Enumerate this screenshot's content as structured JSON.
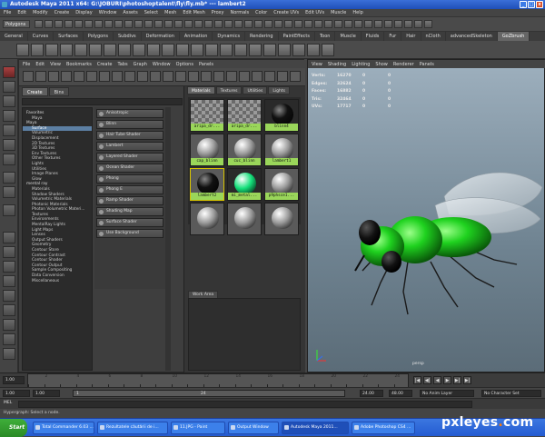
{
  "window": {
    "title": "Autodesk Maya 2011 x64: G:\\JOBURI\\photoshoptalent\\fly\\fly.mb* --- lambert2",
    "min_glyph": "_",
    "max_glyph": "□",
    "close_glyph": "x"
  },
  "main_menu": [
    "File",
    "Edit",
    "Modify",
    "Create",
    "Display",
    "Window",
    "Assets",
    "Select",
    "Mesh",
    "Edit Mesh",
    "Proxy",
    "Normals",
    "Color",
    "Create UVs",
    "Edit UVs",
    "Muscle",
    "Help"
  ],
  "status_line": {
    "mode": "Polygons"
  },
  "shelf_tabs": [
    {
      "label": "General",
      "active": false
    },
    {
      "label": "Curves",
      "active": false
    },
    {
      "label": "Surfaces",
      "active": false
    },
    {
      "label": "Polygons",
      "active": false
    },
    {
      "label": "Subdivs",
      "active": false
    },
    {
      "label": "Deformation",
      "active": false
    },
    {
      "label": "Animation",
      "active": false
    },
    {
      "label": "Dynamics",
      "active": false
    },
    {
      "label": "Rendering",
      "active": false
    },
    {
      "label": "PaintEffects",
      "active": false
    },
    {
      "label": "Toon",
      "active": false
    },
    {
      "label": "Muscle",
      "active": false
    },
    {
      "label": "Fluids",
      "active": false
    },
    {
      "label": "Fur",
      "active": false
    },
    {
      "label": "Hair",
      "active": false
    },
    {
      "label": "nCloth",
      "active": false
    },
    {
      "label": "advancedSkeleton",
      "active": false
    },
    {
      "label": "GoZbrush",
      "active": true
    }
  ],
  "hypershade": {
    "menu": [
      "File",
      "Edit",
      "View",
      "Bookmarks",
      "Create",
      "Tabs",
      "Graph",
      "Window",
      "Options",
      "Panels"
    ],
    "create_tabs": [
      {
        "label": "Create",
        "active": true
      },
      {
        "label": "Bins",
        "active": false
      }
    ],
    "tree": [
      {
        "label": "Favorites",
        "kind": "sec",
        "selected": false
      },
      {
        "label": "Maya",
        "kind": "c1",
        "selected": false
      },
      {
        "label": "Maya",
        "kind": "sec",
        "selected": false
      },
      {
        "label": "Surface",
        "kind": "c1",
        "selected": true
      },
      {
        "label": "Volumetric",
        "kind": "c1",
        "selected": false
      },
      {
        "label": "Displacement",
        "kind": "c1",
        "selected": false
      },
      {
        "label": "2D Textures",
        "kind": "c1",
        "selected": false
      },
      {
        "label": "3D Textures",
        "kind": "c1",
        "selected": false
      },
      {
        "label": "Env Textures",
        "kind": "c1",
        "selected": false
      },
      {
        "label": "Other Textures",
        "kind": "c1",
        "selected": false
      },
      {
        "label": "Lights",
        "kind": "c1",
        "selected": false
      },
      {
        "label": "Utilities",
        "kind": "c1",
        "selected": false
      },
      {
        "label": "Image Planes",
        "kind": "c1",
        "selected": false
      },
      {
        "label": "Glow",
        "kind": "c1",
        "selected": false
      },
      {
        "label": "mental ray",
        "kind": "sec",
        "selected": false
      },
      {
        "label": "Materials",
        "kind": "c1",
        "selected": false
      },
      {
        "label": "Shadow Shaders",
        "kind": "c1",
        "selected": false
      },
      {
        "label": "Volumetric Materials",
        "kind": "c1",
        "selected": false
      },
      {
        "label": "Photonic Materials",
        "kind": "c1",
        "selected": false
      },
      {
        "label": "Photon Volumetric Materi...",
        "kind": "c1",
        "selected": false
      },
      {
        "label": "Textures",
        "kind": "c1",
        "selected": false
      },
      {
        "label": "Environments",
        "kind": "c1",
        "selected": false
      },
      {
        "label": "MentalRay Lights",
        "kind": "c1",
        "selected": false
      },
      {
        "label": "Light Maps",
        "kind": "c1",
        "selected": false
      },
      {
        "label": "Lenses",
        "kind": "c1",
        "selected": false
      },
      {
        "label": "Output Shaders",
        "kind": "c1",
        "selected": false
      },
      {
        "label": "Geometry",
        "kind": "c1",
        "selected": false
      },
      {
        "label": "Contour Store",
        "kind": "c1",
        "selected": false
      },
      {
        "label": "Contour Contrast",
        "kind": "c1",
        "selected": false
      },
      {
        "label": "Contour Shader",
        "kind": "c1",
        "selected": false
      },
      {
        "label": "Contour Output",
        "kind": "c1",
        "selected": false
      },
      {
        "label": "Sample Compositing",
        "kind": "c1",
        "selected": false
      },
      {
        "label": "Data Conversion",
        "kind": "c1",
        "selected": false
      },
      {
        "label": "Miscellaneous",
        "kind": "c1",
        "selected": false
      }
    ],
    "nodes": [
      "Anisotropic",
      "Blinn",
      "Hair Tube Shader",
      "Lambert",
      "Layered Shader",
      "Ocean Shader",
      "Phong",
      "Phong E",
      "Ramp Shader",
      "Shading Map",
      "Surface Shader",
      "Use Background"
    ],
    "material_tabs": [
      {
        "label": "Materials",
        "active": true
      },
      {
        "label": "Textures",
        "active": false
      },
      {
        "label": "Utilities",
        "active": false
      },
      {
        "label": "Lights",
        "active": false
      }
    ],
    "swatches": [
      {
        "label": "aripa_dr...",
        "style": "checker",
        "ball": "none"
      },
      {
        "label": "aripa_dr...",
        "style": "checker",
        "ball": "none"
      },
      {
        "label": "blinn4",
        "style": "dark",
        "ball": "#111111"
      },
      {
        "label": "cap_blinn",
        "style": "plain",
        "ball": "#9a9a9a"
      },
      {
        "label": "cuc_blinn",
        "style": "plain",
        "ball": "#9a9a9a"
      },
      {
        "label": "lambert1",
        "style": "plain",
        "ball": "#9a9a9a"
      },
      {
        "label": "lambert2",
        "style": "yel",
        "ball": "#0d0d0d"
      },
      {
        "label": "mi_metal...",
        "style": "dark",
        "ball": "#14e07a"
      },
      {
        "label": "p9phsce1...",
        "style": "plain",
        "ball": "#9a9a9a"
      },
      {
        "label": "",
        "style": "plain",
        "ball": "#9a9a9a"
      },
      {
        "label": "",
        "style": "plain",
        "ball": "#9a9a9a"
      },
      {
        "label": "",
        "style": "plain",
        "ball": "#9a9a9a"
      }
    ],
    "work_area_tab": "Work Area"
  },
  "viewport": {
    "menu": [
      "View",
      "Shading",
      "Lighting",
      "Show",
      "Renderer",
      "Panels"
    ],
    "hud": [
      {
        "label": "Verts:",
        "v1": "16270",
        "v2": "0",
        "v3": "0"
      },
      {
        "label": "Edges:",
        "v1": "32624",
        "v2": "0",
        "v3": "0"
      },
      {
        "label": "Faces:",
        "v1": "16882",
        "v2": "0",
        "v3": "0"
      },
      {
        "label": "Tris:",
        "v1": "32464",
        "v2": "0",
        "v3": "0"
      },
      {
        "label": "UVs:",
        "v1": "17717",
        "v2": "0",
        "v3": "0"
      }
    ],
    "camera_label": "persp"
  },
  "timeline": {
    "ticks": [
      "2",
      "4",
      "6",
      "8",
      "10",
      "12",
      "14",
      "16",
      "18",
      "20",
      "22",
      "24"
    ],
    "current_frame": "1.00",
    "buttons": [
      "|◀",
      "◀|",
      "◀",
      "▶",
      "▶|",
      "▶|"
    ]
  },
  "range": {
    "start": "1.00",
    "start2": "1.00",
    "slider_lo": "1",
    "slider_hi": "24",
    "end": "24.00",
    "end2": "48.00",
    "anim_layer": "No Anim Layer",
    "char_set": "No Character Set"
  },
  "command": {
    "label": "MEL"
  },
  "help_line": "Hypergraph: Select a node.",
  "taskbar": {
    "start": "Start",
    "tasks": [
      {
        "label": "Total Commander 6.03 ...",
        "active": false
      },
      {
        "label": "Rezultatele căutării de i...",
        "active": false
      },
      {
        "label": "11.JPG - Paint",
        "active": false
      },
      {
        "label": "Output Window",
        "active": false
      },
      {
        "label": "Autodesk Maya 2011...",
        "active": true
      },
      {
        "label": "Adobe Photoshop CS4 ...",
        "active": false
      }
    ]
  },
  "watermark": {
    "pre": "pxleyes",
    "dot": ".",
    "post": "com"
  },
  "colors": {
    "accent_green": "#9ad65a",
    "fly_green": "#1fd21f",
    "selection": "#5c7fa3"
  }
}
